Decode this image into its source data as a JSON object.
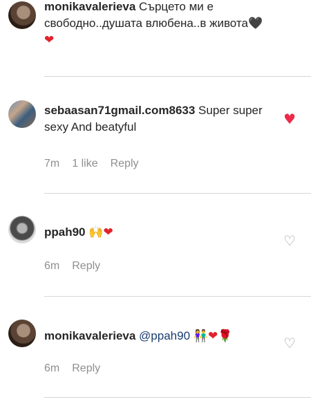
{
  "comments": [
    {
      "username": "monikavalerieva",
      "text": " Сърцето ми е свободно..душата влюбена..в живота",
      "emojis": [
        "🖤",
        "❤"
      ]
    },
    {
      "username": "sebaasan71gmail.com8633",
      "text": " Super super sexy And beatyful",
      "time": "7m",
      "likes": "1 like",
      "reply": "Reply",
      "liked": true
    },
    {
      "username": "ppah90",
      "text": " ",
      "emojis": [
        "🙌",
        "❤"
      ],
      "time": "6m",
      "reply": "Reply",
      "liked": false
    },
    {
      "username": "monikavalerieva",
      "mention": "@ppah90",
      "emojis": [
        "👫",
        "❤",
        "🌹"
      ],
      "time": "6m",
      "reply": "Reply",
      "liked": false
    }
  ],
  "icons": {
    "heart_filled": "♥",
    "heart_outline": "♡"
  }
}
